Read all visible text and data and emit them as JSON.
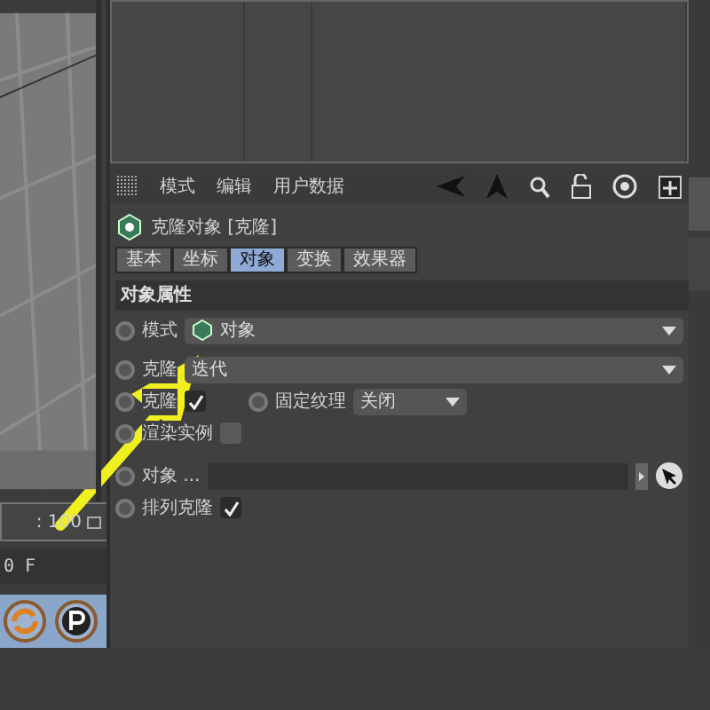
{
  "timeline": {
    "range_end": ": 100",
    "frame": "0 F"
  },
  "menu": [
    "模式",
    "编辑",
    "用户数据"
  ],
  "object_title": "克隆对象 [克隆]",
  "tabs": [
    {
      "label": "基本",
      "selected": false
    },
    {
      "label": "坐标",
      "selected": false
    },
    {
      "label": "对象",
      "selected": true
    },
    {
      "label": "变换",
      "selected": false
    },
    {
      "label": "效果器",
      "selected": false
    }
  ],
  "section_title": "对象属性",
  "rows": [
    {
      "kind": "dropdown",
      "label": "模式",
      "value": "对象",
      "animated": false
    },
    {
      "kind": "dropdown",
      "label": "克隆",
      "value": "迭代",
      "animated": false
    },
    {
      "kind": "check_pair",
      "label": "克隆",
      "checked": true,
      "animated": false,
      "label2": "固定纹理",
      "value2": "关闭",
      "animated2": false
    },
    {
      "kind": "checkbox",
      "label": "渲染实例",
      "checked": false,
      "animated": false
    },
    {
      "kind": "link",
      "label": "对象 ...",
      "animated": false
    },
    {
      "kind": "checkbox",
      "label": "排列克隆",
      "checked": true,
      "animated": false
    }
  ]
}
